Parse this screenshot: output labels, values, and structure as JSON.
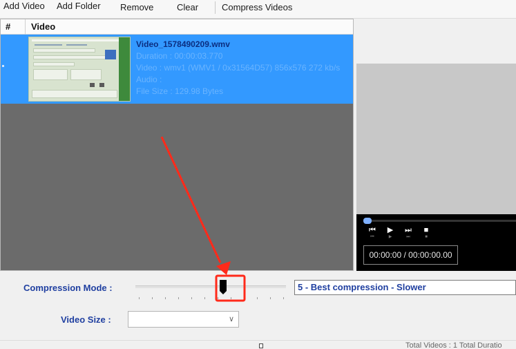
{
  "toolbar": {
    "add_video": "Add Video",
    "add_folder": "Add Folder",
    "remove": "Remove",
    "clear": "Clear",
    "compress": "Compress Videos"
  },
  "list": {
    "col_hash": "#",
    "col_video": "Video",
    "rows": [
      {
        "title": "Video_1578490209.wmv",
        "duration": "Duration : 00:00:03.770",
        "video": "Video : wmv1 (WMV1 / 0x31564D57) 856x576 272 kb/s",
        "audio": "Audio :",
        "file_size": "File Size : 129.98 Bytes"
      }
    ]
  },
  "player": {
    "time": "00:00:00 / 00:00:00.00"
  },
  "controls": {
    "compression_label": "Compression Mode :",
    "compression_value": "5 - Best compression - Slower",
    "compression_level": 5,
    "compression_max": 6,
    "video_size_label": "Video Size :",
    "video_size_value": ""
  },
  "status": {
    "text": "Total Videos : 1   Total Duratio"
  },
  "colors": {
    "selection": "#3399ff",
    "label_blue": "#1f3fa0",
    "annotation_red": "#ff2a1a"
  }
}
